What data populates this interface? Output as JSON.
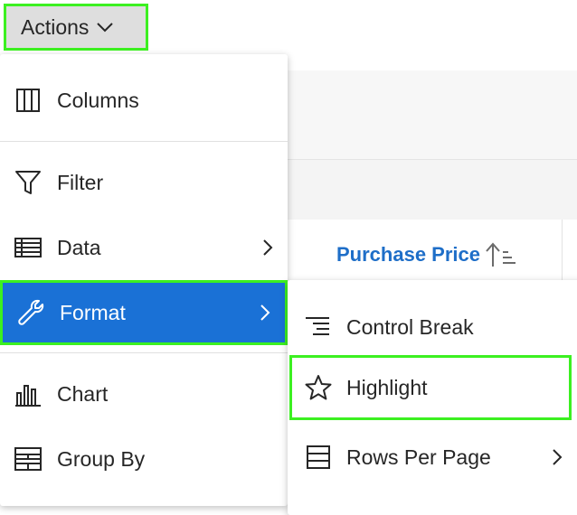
{
  "actions_button": {
    "label": "Actions",
    "icon": "chevron-down-icon"
  },
  "report": {
    "column_header": "Purchase Price",
    "sort_icon": "sort-ascending-icon",
    "link_color": "#1e6ec8"
  },
  "main_menu": {
    "items": [
      {
        "label": "Columns",
        "icon": "columns-icon"
      },
      {
        "label": "Filter",
        "icon": "filter-icon"
      },
      {
        "label": "Data",
        "icon": "table-icon",
        "has_submenu": true
      },
      {
        "label": "Format",
        "icon": "wrench-icon",
        "has_submenu": true,
        "active": true
      },
      {
        "label": "Chart",
        "icon": "bar-chart-icon"
      },
      {
        "label": "Group By",
        "icon": "group-by-icon"
      }
    ]
  },
  "format_submenu": {
    "items": [
      {
        "label": "Control Break",
        "icon": "control-break-icon"
      },
      {
        "label": "Highlight",
        "icon": "star-icon",
        "focused": true
      },
      {
        "label": "Rows Per Page",
        "icon": "rows-per-page-icon",
        "has_submenu": true
      }
    ]
  },
  "colors": {
    "active_bg": "#1a71d6",
    "focus_outline": "#3cf021",
    "button_bg": "#dedede"
  }
}
